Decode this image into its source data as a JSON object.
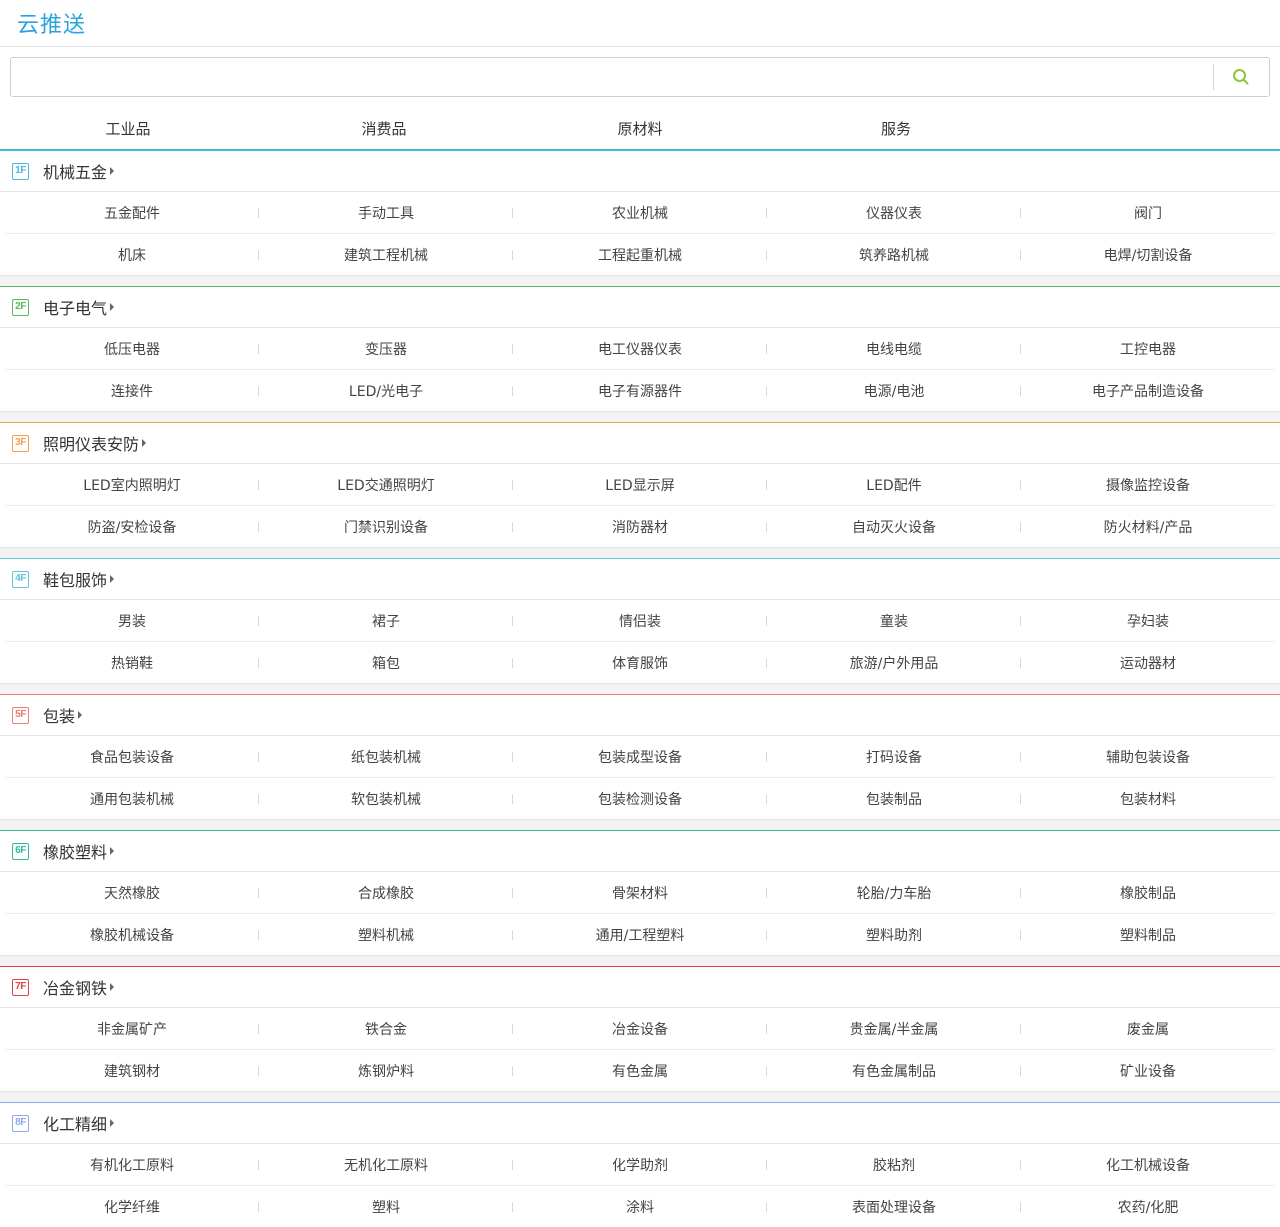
{
  "header": {
    "logo": "云推送"
  },
  "search": {
    "placeholder": "",
    "value": ""
  },
  "tabs": [
    {
      "label": "工业品"
    },
    {
      "label": "消费品"
    },
    {
      "label": "原材料"
    },
    {
      "label": "服务"
    }
  ],
  "floors": [
    {
      "badge": "1F",
      "color": "#47b8e0",
      "title": "机械五金",
      "rows": [
        [
          "五金配件",
          "手动工具",
          "农业机械",
          "仪器仪表",
          "阀门"
        ],
        [
          "机床",
          "建筑工程机械",
          "工程起重机械",
          "筑养路机械",
          "电焊/切割设备"
        ]
      ]
    },
    {
      "badge": "2F",
      "color": "#5cb85c",
      "title": "电子电气",
      "rows": [
        [
          "低压电器",
          "变压器",
          "电工仪器仪表",
          "电线电缆",
          "工控电器"
        ],
        [
          "连接件",
          "LED/光电子",
          "电子有源器件",
          "电源/电池",
          "电子产品制造设备"
        ]
      ]
    },
    {
      "badge": "3F",
      "color": "#f0a050",
      "title": "照明仪表安防",
      "rows": [
        [
          "LED室内照明灯",
          "LED交通照明灯",
          "LED显示屏",
          "LED配件",
          "摄像监控设备"
        ],
        [
          "防盗/安检设备",
          "门禁识别设备",
          "消防器材",
          "自动灭火设备",
          "防火材料/产品"
        ]
      ]
    },
    {
      "badge": "4F",
      "color": "#5bc8d9",
      "title": "鞋包服饰",
      "rows": [
        [
          "男装",
          "裙子",
          "情侣装",
          "童装",
          "孕妇装"
        ],
        [
          "热销鞋",
          "箱包",
          "体育服饰",
          "旅游/户外用品",
          "运动器材"
        ]
      ]
    },
    {
      "badge": "5F",
      "color": "#ee7d6e",
      "title": "包装",
      "rows": [
        [
          "食品包装设备",
          "纸包装机械",
          "包装成型设备",
          "打码设备",
          "辅助包装设备"
        ],
        [
          "通用包装机械",
          "软包装机械",
          "包装检测设备",
          "包装制品",
          "包装材料"
        ]
      ]
    },
    {
      "badge": "6F",
      "color": "#33b8a0",
      "title": "橡胶塑料",
      "rows": [
        [
          "天然橡胶",
          "合成橡胶",
          "骨架材料",
          "轮胎/力车胎",
          "橡胶制品"
        ],
        [
          "橡胶机械设备",
          "塑料机械",
          "通用/工程塑料",
          "塑料助剂",
          "塑料制品"
        ]
      ]
    },
    {
      "badge": "7F",
      "color": "#e0404a",
      "title": "冶金钢铁",
      "rows": [
        [
          "非金属矿产",
          "铁合金",
          "冶金设备",
          "贵金属/半金属",
          "废金属"
        ],
        [
          "建筑钢材",
          "炼钢炉料",
          "有色金属",
          "有色金属制品",
          "矿业设备"
        ]
      ]
    },
    {
      "badge": "8F",
      "color": "#8fa8e8",
      "title": "化工精细",
      "rows": [
        [
          "有机化工原料",
          "无机化工原料",
          "化学助剂",
          "胶粘剂",
          "化工机械设备"
        ],
        [
          "化学纤维",
          "塑料",
          "涂料",
          "表面处理设备",
          "农药/化肥"
        ]
      ]
    }
  ]
}
